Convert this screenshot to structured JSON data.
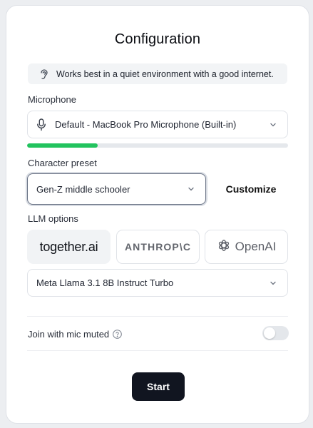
{
  "title": "Configuration",
  "notice": {
    "text": "Works best in a quiet environment with a good internet.",
    "icon": "ear-icon"
  },
  "microphone": {
    "label": "Microphone",
    "selected": "Default - MacBook Pro Microphone (Built-in)",
    "level": 0.27,
    "level_color": "#22c35e"
  },
  "character": {
    "label": "Character preset",
    "selected": "Gen-Z middle schooler",
    "customize_label": "Customize"
  },
  "llm": {
    "label": "LLM options",
    "providers": [
      {
        "name": "together.ai",
        "selected": true
      },
      {
        "name": "ANTHROP\\C",
        "selected": false
      },
      {
        "name": "OpenAI",
        "selected": false
      }
    ],
    "model": "Meta Llama 3.1 8B Instruct Turbo"
  },
  "mute": {
    "label": "Join with mic muted",
    "enabled": false
  },
  "start_label": "Start",
  "colors": {
    "primary_button": "#111520",
    "accent": "#22c35e"
  }
}
